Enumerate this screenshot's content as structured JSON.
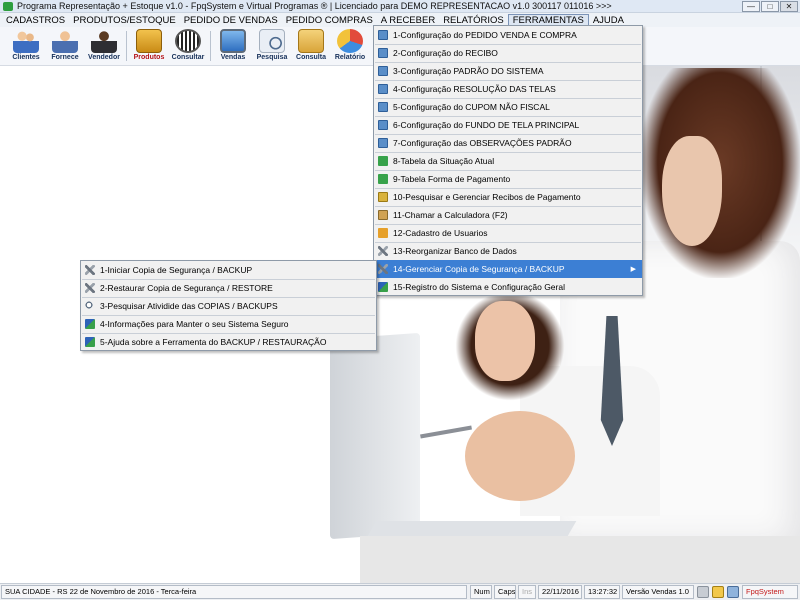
{
  "window": {
    "title": "Programa Representação + Estoque v1.0 - FpqSystem e Virtual Programas ® | Licenciado para  DEMO REPRESENTACAO v1.0 300117 011016 >>>",
    "minimize": "—",
    "maximize": "□",
    "close": "✕"
  },
  "menubar": [
    "CADASTROS",
    "PRODUTOS/ESTOQUE",
    "PEDIDO DE VENDAS",
    "PEDIDO COMPRAS",
    "A RECEBER",
    "RELATÓRIOS",
    "FERRAMENTAS",
    "AJUDA"
  ],
  "toolbar": [
    "Clientes",
    "Fornece",
    "Vendedor",
    "Produtos",
    "Consultar",
    "Vendas",
    "Pesquisa",
    "Consulta",
    "Relatório"
  ],
  "ferramentas_menu": [
    {
      "label": "1-Configuração do PEDIDO VENDA E COMPRA",
      "icon": "config-icon"
    },
    {
      "label": "2-Configuração do RECIBO",
      "icon": "config-icon"
    },
    {
      "label": "3-Configuração PADRÃO DO SISTEMA",
      "icon": "config-icon"
    },
    {
      "label": "4-Configuração RESOLUÇÃO DAS TELAS",
      "icon": "config-icon"
    },
    {
      "label": "5-Configuração do CUPOM NÃO FISCAL",
      "icon": "config-icon"
    },
    {
      "label": "6-Configuração do FUNDO DE TELA PRINCIPAL",
      "icon": "config-icon"
    },
    {
      "label": "7-Configuração das OBSERVAÇÕES PADRÃO",
      "icon": "config-icon"
    },
    {
      "label": "8-Tabela da Situação Atual",
      "icon": "table-icon"
    },
    {
      "label": "9-Tabela Forma de Pagamento",
      "icon": "table-icon"
    },
    {
      "label": "10-Pesquisar e Gerenciar Recibos de Pagamento",
      "icon": "money-icon"
    },
    {
      "label": "11-Chamar a Calculadora (F2)",
      "icon": "calculator-icon"
    },
    {
      "label": "12-Cadastro de Usuarios",
      "icon": "users-icon"
    },
    {
      "label": "13-Reorganizar Banco de Dados",
      "icon": "tools-icon"
    },
    {
      "label": "14-Gerenciar Copia de Segurança / BACKUP",
      "icon": "tools-icon"
    },
    {
      "label": "15-Registro do Sistema e Configuração Geral",
      "icon": "check-icon"
    }
  ],
  "backup_submenu": [
    {
      "label": "1-Iniciar Copia de Segurança / BACKUP",
      "icon": "tools-icon"
    },
    {
      "label": "2-Restaurar Copia de Segurança / RESTORE",
      "icon": "tools-icon"
    },
    {
      "label": "3-Pesquisar Atividide das COPIAS / BACKUPS",
      "icon": "search-icon"
    },
    {
      "label": "4-Informações para Manter o seu Sistema Seguro",
      "icon": "check-icon"
    },
    {
      "label": "5-Ajuda sobre a Ferramenta do BACKUP / RESTAURAÇÃO",
      "icon": "check-icon"
    }
  ],
  "statusbar": {
    "location_date": "SUA CIDADE - RS 22 de Novembro de 2016 - Terca-feira",
    "num": "Num",
    "caps": "Caps",
    "ins": "Ins",
    "date": "22/11/2016",
    "time": "13:27:32",
    "version": "Versão Vendas 1.0",
    "brand": "FpqSystem"
  },
  "colors": {
    "highlight": "#3c7fd4",
    "brand_text": "#c41a1a"
  }
}
